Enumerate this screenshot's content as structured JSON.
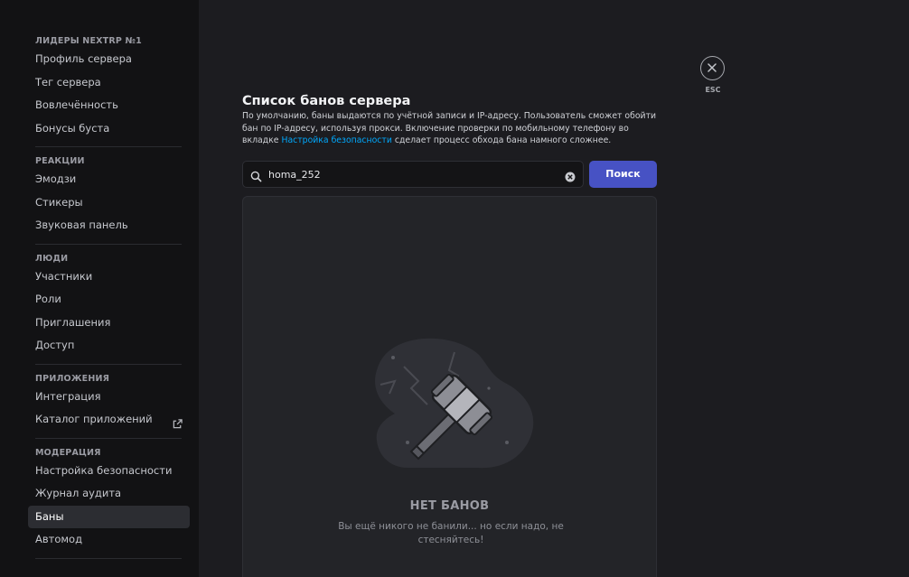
{
  "sidebar": {
    "sections": [
      {
        "header": "ЛИДЕРЫ NEXTRP №1",
        "items": [
          {
            "label": "Профиль сервера"
          },
          {
            "label": "Тег сервера"
          },
          {
            "label": "Вовлечённость"
          },
          {
            "label": "Бонусы буста"
          }
        ]
      },
      {
        "header": "РЕАКЦИИ",
        "items": [
          {
            "label": "Эмодзи"
          },
          {
            "label": "Стикеры"
          },
          {
            "label": "Звуковая панель"
          }
        ]
      },
      {
        "header": "ЛЮДИ",
        "items": [
          {
            "label": "Участники"
          },
          {
            "label": "Роли"
          },
          {
            "label": "Приглашения"
          },
          {
            "label": "Доступ"
          }
        ]
      },
      {
        "header": "ПРИЛОЖЕНИЯ",
        "items": [
          {
            "label": "Интеграция"
          },
          {
            "label": "Каталог приложений",
            "icon": "external-link-icon"
          }
        ]
      },
      {
        "header": "МОДЕРАЦИЯ",
        "items": [
          {
            "label": "Настройка безопасности"
          },
          {
            "label": "Журнал аудита"
          },
          {
            "label": "Баны",
            "active": true
          },
          {
            "label": "Автомод"
          }
        ]
      }
    ]
  },
  "main": {
    "title": "Список банов сервера",
    "description_before_link": "По умолчанию, баны выдаются по учётной записи и IP-адресу. Пользователь сможет обойти бан по IP-адресу, используя прокси. Включение проверки по мобильному телефону во вкладке ",
    "description_link": "Настройка безопасности",
    "description_after_link": " сделает процесс обхода бана намного сложнее.",
    "search": {
      "value": "homa_252",
      "button_label": "Поиск"
    },
    "empty_state": {
      "title": "НЕТ БАНОВ",
      "text": "Вы ещё никого не банили... но если надо, не стесняйтесь!"
    }
  },
  "close": {
    "label": "ESC"
  },
  "colors": {
    "accent": "#4752c4",
    "link": "#00a8fc",
    "sidebar_bg": "#121214",
    "content_bg": "#1c1c20"
  }
}
